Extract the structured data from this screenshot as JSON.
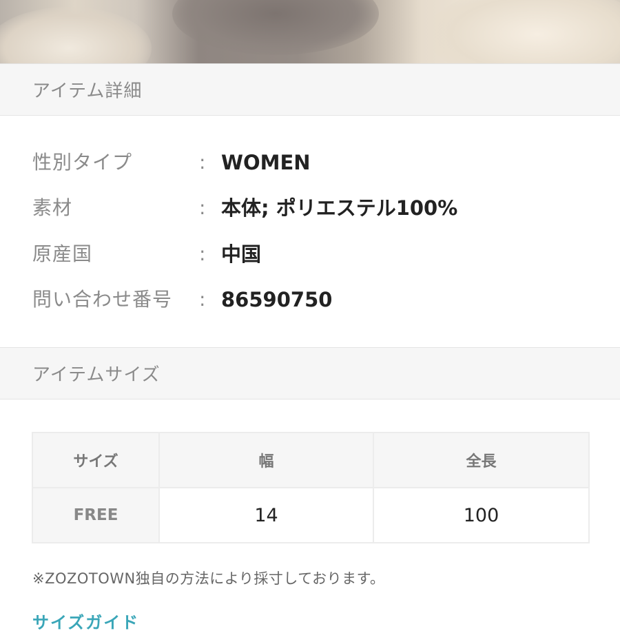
{
  "item_details": {
    "header": "アイテム詳細",
    "rows": [
      {
        "label": "性別タイプ",
        "colon": ":",
        "value": "WOMEN"
      },
      {
        "label": "素材",
        "colon": ":",
        "value": "本体; ポリエステル100%"
      },
      {
        "label": "原産国",
        "colon": ":",
        "value": "中国"
      },
      {
        "label": "問い合わせ番号",
        "colon": ":",
        "value": "86590750"
      }
    ]
  },
  "item_size": {
    "header": "アイテムサイズ",
    "columns": [
      "サイズ",
      "幅",
      "全長"
    ],
    "rows": [
      {
        "size": "FREE",
        "width": "14",
        "length": "100"
      }
    ],
    "note": "※ZOZOTOWN独自の方法により採寸しております。",
    "guide_link": "サイズガイド"
  },
  "colors": {
    "label_gray": "#8a8a8a",
    "header_bg": "#f6f6f6",
    "link_teal": "#3aa6b8"
  }
}
